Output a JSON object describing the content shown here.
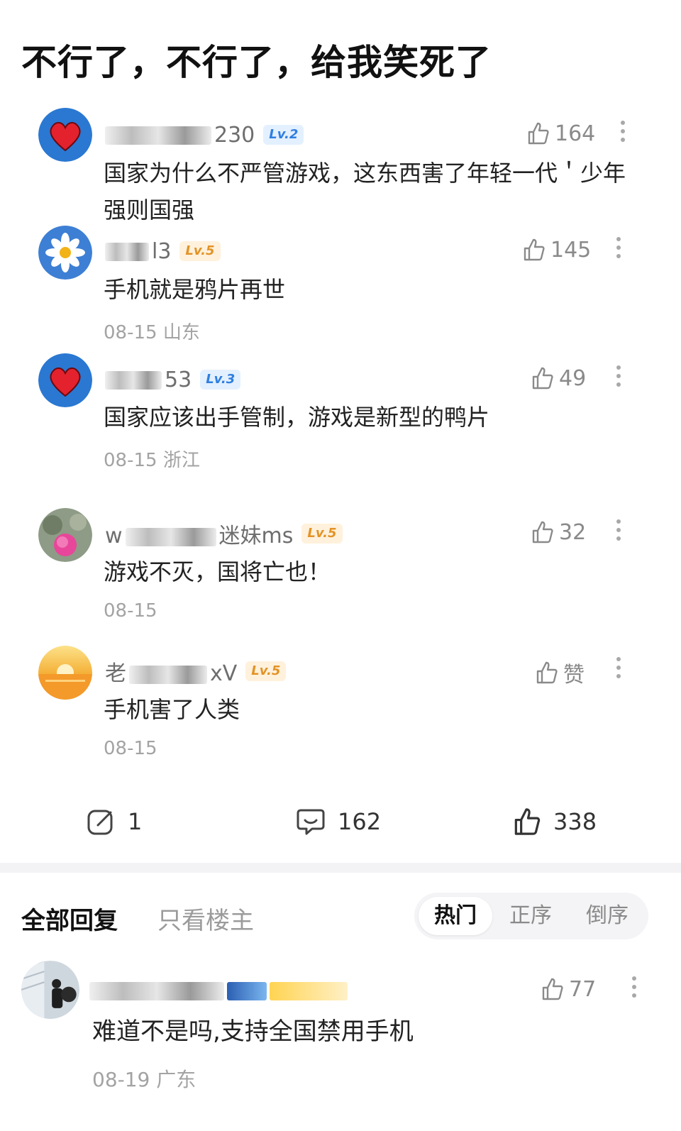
{
  "post": {
    "title": "不行了，不行了，给我笑死了"
  },
  "comments": [
    {
      "username": "230",
      "level": "Lv.2",
      "likes": "164",
      "text": "国家为什么不严管游戏，这东西害了年轻一代＇少年强则国强",
      "date": ""
    },
    {
      "username": "l3",
      "level": "Lv.5",
      "likes": "145",
      "text": "手机就是鸦片再世",
      "date": "08-15 山东"
    },
    {
      "username": "53",
      "level": "Lv.3",
      "likes": "49",
      "text": "国家应该出手管制，游戏是新型的鸭片",
      "date": "08-15 浙江"
    },
    {
      "username_prefix": "w",
      "username": "迷妹ms",
      "level": "Lv.5",
      "likes": "32",
      "text": "游戏不灭，国将亡也！",
      "date": "08-15"
    },
    {
      "username_prefix": "老",
      "username": "xV",
      "level": "Lv.5",
      "likes": "赞",
      "text": "手机害了人类",
      "date": "08-15"
    }
  ],
  "actions": {
    "share_count": "1",
    "comment_count": "162",
    "like_count": "338"
  },
  "replies": {
    "tab_all": "全部回复",
    "tab_host": "只看楼主",
    "sort_options": [
      "热门",
      "正序",
      "倒序"
    ],
    "first_reply": {
      "likes": "77",
      "text": "难道不是吗,支持全国禁用手机",
      "date": "08-19 广东"
    }
  },
  "colors": {
    "level_blue": "#2f7fe0",
    "level_orange": "#e29326",
    "muted": "#a3a3a3"
  }
}
